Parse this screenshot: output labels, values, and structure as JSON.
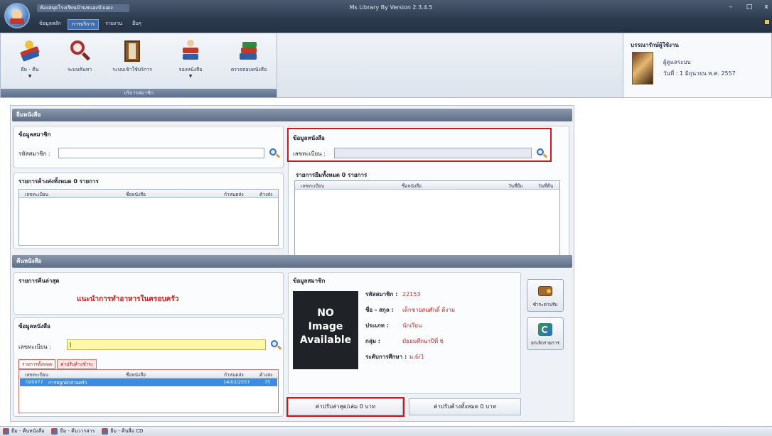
{
  "titlebar": {
    "quick_title": "ห้องสมุดโรงเรียนบ้านหนองบัวแดง",
    "window_title": "Ms Library By Version 2.3.4.5",
    "menu_tabs": [
      "ข้อมูลหลัก",
      "การบริการ",
      "รายงาน",
      "อื่นๆ"
    ],
    "minimize": "–",
    "maximize": "□",
    "close": "x"
  },
  "ribbon": {
    "buttons": [
      {
        "label": "ยืม - คืน",
        "icon": "books-icon"
      },
      {
        "label": "ระบบค้นหา",
        "icon": "magnifier-icon"
      },
      {
        "label": "ระบบเข้าใช้บริการ",
        "icon": "door-icon"
      },
      {
        "label": "จองหนังสือ",
        "icon": "person-book-icon"
      },
      {
        "label": "ตรวจสอบหนังสือ",
        "icon": "bookstack-icon"
      }
    ],
    "group_label": "บริการสมาชิก"
  },
  "user": {
    "title": "บรรณารักษ์ผู้ใช้งาน",
    "name": "ผู้ดูแลระบบ",
    "date": "วันที่ : 1 มิถุนายน พ.ศ. 2557"
  },
  "borrow": {
    "section_title": "ยืมหนังสือ",
    "member_panel_title": "ข้อมูลสมาชิก",
    "member_code_label": "รหัสสมาชิก :",
    "member_code_value": "",
    "overdue_title": "รายการค้างส่งทั้งหมด 0 รายการ",
    "overdue_columns": [
      "เลขทะเบียน",
      "ชื่อหนังสือ",
      "กำหนดส่ง",
      "ค้างส่ง"
    ],
    "book_panel_title": "ข้อมูลหนังสือ",
    "book_reg_label": "เลขทะเบียน :",
    "book_reg_value": "",
    "borrow_list_title": "รายการยืมทั้งหมด 0 รายการ",
    "borrow_columns": [
      "เลขทะเบียน",
      "ชื่อหนังสือ",
      "วันที่ยืม",
      "วันที่คืน"
    ]
  },
  "return": {
    "section_title": "คืนหนังสือ",
    "latest_title": "รายการคืนล่าสุด",
    "latest_book": "แนะนำการทำอาหารในครอบครัว",
    "book_panel_title": "ข้อมูลหนังสือ",
    "book_reg_label": "เลขทะเบียน :",
    "book_reg_value": "|",
    "tabs": [
      "รายการทั้งหมด",
      "ค่าปรับค้างชำระ"
    ],
    "columns": [
      "เลขทะเบียน",
      "ชื่อหนังสือ",
      "กำหนดส่ง",
      "ค้างส่ง"
    ],
    "rows": [
      {
        "reg": "020077",
        "title": "การปลูกผักสวนครัว",
        "due": "14/02/2557",
        "late": "75"
      }
    ],
    "member_panel_title": "ข้อมูลสมาชิก",
    "no_image_text": [
      "NO",
      "Image",
      "Available"
    ],
    "member_info": [
      {
        "k": "รหัสสมาชิก :",
        "v": "22153"
      },
      {
        "k": "ชื่อ - สกุล :",
        "v": "เด็กชายสมศักดิ์ ดีงาม"
      },
      {
        "k": "ประเภท :",
        "v": "นักเรียน"
      },
      {
        "k": "กลุ่ม :",
        "v": "มัธยมศึกษาปีที่ 6"
      },
      {
        "k": "ระดับการศึกษา :",
        "v": "ม.6/1"
      }
    ],
    "fine_latest_button": "ค่าปรับล่าสุด/เล่ม 0 บาท",
    "fine_total_button": "ค่าปรับค้างทั้งหมด 0 บาท",
    "side_buttons": [
      {
        "label": "ชำระค่าปรับ",
        "icon": "wallet-icon"
      },
      {
        "label": "ยกเลิกรายการ",
        "icon": "refresh-icon"
      }
    ]
  },
  "statusbar": {
    "tabs": [
      "ยืม - คืนหนังสือ",
      "ยืม - คืนวารสาร",
      "ยืม - คืนสื่อ CD"
    ]
  }
}
